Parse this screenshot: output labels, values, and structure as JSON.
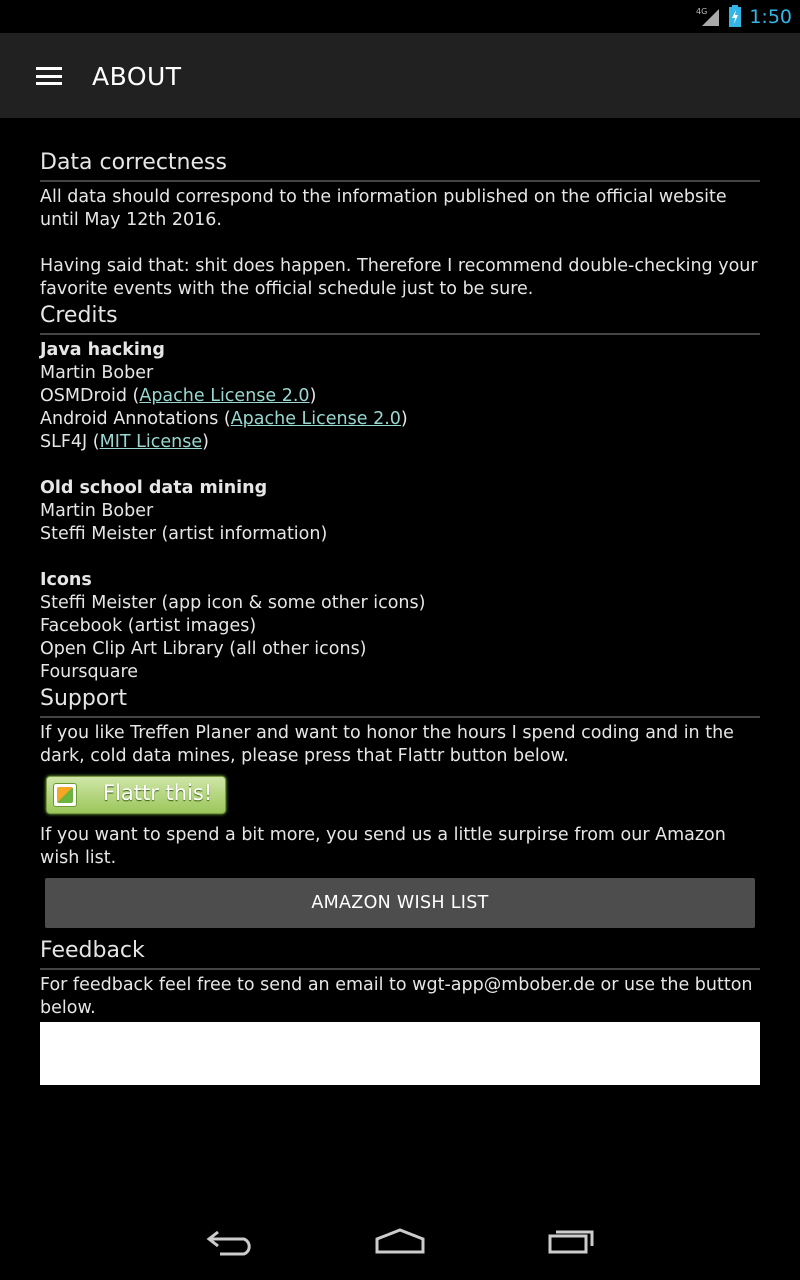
{
  "status_bar": {
    "time": "1:50",
    "network": "4G",
    "signal_icon": "signal-icon",
    "battery_icon": "battery-charging-icon",
    "time_color": "#33b5e5"
  },
  "action_bar": {
    "title": "ABOUT",
    "menu_icon": "hamburger-icon",
    "bg": "#212121"
  },
  "data_correctness": {
    "heading": "Data correctness",
    "para1": "All data should correspond to the information published on the official website until May 12th 2016.",
    "para2": "Having said that: shit does happen. Therefore I recommend double-checking your favorite events with the official schedule just to be sure."
  },
  "credits": {
    "heading": "Credits",
    "java": {
      "title": "Java hacking",
      "lines": [
        {
          "pre": "Martin Bober"
        },
        {
          "pre": "OSMDroid (",
          "link": "Apache License 2.0",
          "post": ")"
        },
        {
          "pre": "Android Annotations (",
          "link": "Apache License 2.0",
          "post": ")"
        },
        {
          "pre": "SLF4J (",
          "link": "MIT License",
          "post": ")"
        }
      ]
    },
    "mining": {
      "title": "Old school data mining",
      "lines": [
        "Martin Bober",
        "Steffi Meister (artist information)"
      ]
    },
    "icons": {
      "title": "Icons",
      "lines": [
        "Steffi Meister (app icon & some other icons)",
        "Facebook (artist images)",
        "Open Clip Art Library (all other icons)",
        "Foursquare"
      ]
    }
  },
  "support": {
    "heading": "Support",
    "para1": "If you like Treffen Planer and want to honor the hours I spend coding and in the dark, cold data mines, please press that Flattr button below.",
    "flattr_label": "Flattr this!",
    "para2": "If you want to spend a bit more, you send us a little surpirse from our Amazon wish list.",
    "wish_button": "AMAZON WISH LIST"
  },
  "feedback": {
    "heading": "Feedback",
    "para": "For feedback feel free to send an email to wgt-app@mbober.de or use the button below."
  },
  "nav_bar": {
    "icons": [
      "back-icon",
      "home-icon",
      "recents-icon"
    ]
  }
}
